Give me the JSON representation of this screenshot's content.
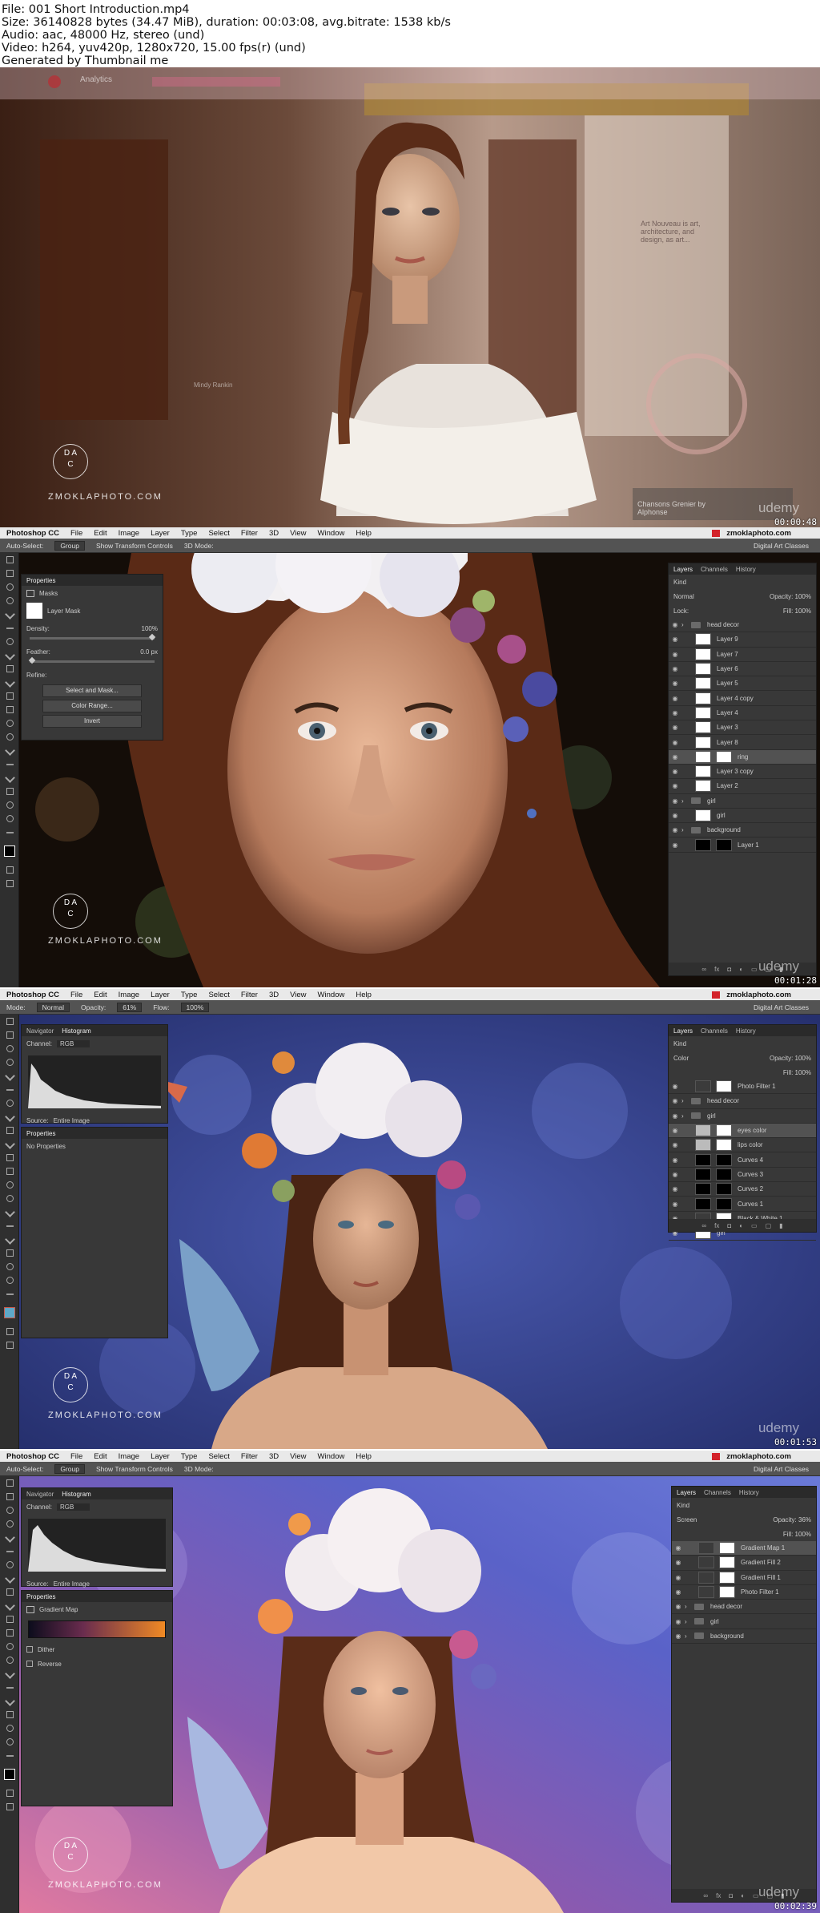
{
  "header": {
    "file": "File: 001 Short Introduction.mp4",
    "size": "Size: 36140828 bytes (34.47 MiB), duration: 00:03:08, avg.bitrate: 1538 kb/s",
    "audio": "Audio: aac, 48000 Hz, stereo (und)",
    "video": "Video: h264, yuv420p, 1280x720, 15.00 fps(r) (und)",
    "generator": "Generated by Thumbnail me"
  },
  "watermark": "ZMOKLAPHOTO.COM",
  "watermark_logo": [
    "D",
    "A",
    "C"
  ],
  "brand": "udemy",
  "menubar": {
    "app": "Photoshop CC",
    "items": [
      "File",
      "Edit",
      "Image",
      "Layer",
      "Type",
      "Select",
      "Filter",
      "3D",
      "View",
      "Window",
      "Help"
    ],
    "site": "zmoklaphoto.com",
    "workspace": "Digital Art Classes"
  },
  "frames": [
    {
      "timestamp": "00:00:48",
      "pinterest": {
        "title": "Analytics",
        "card1": "Art Nouveau is art, architecture, and design, as art...",
        "card2": "Chansons Grenier by Alphonse",
        "card3": "Mindy Rankin"
      }
    },
    {
      "timestamp": "00:01:28",
      "options": [
        "Auto-Select:",
        "Group",
        "Show Transform Controls",
        "3D Mode:"
      ],
      "properties": {
        "tabs": [
          "Properties"
        ],
        "title": "Masks",
        "mask": "Layer Mask",
        "density_label": "Density:",
        "density_value": "100%",
        "feather_label": "Feather:",
        "feather_value": "0.0 px",
        "refine": "Refine:",
        "buttons": [
          "Select and Mask...",
          "Color Range...",
          "Invert"
        ]
      },
      "layers": {
        "tabs": [
          "Layers",
          "Channels",
          "History"
        ],
        "kind": "Kind",
        "blend": "Normal",
        "opacity": "Opacity: 100%",
        "lock": "Lock:",
        "fill": "Fill: 100%",
        "items": [
          {
            "name": "head decor",
            "type": "group"
          },
          {
            "name": "Layer 9",
            "type": "layer"
          },
          {
            "name": "Layer 7",
            "type": "layer"
          },
          {
            "name": "Layer 6",
            "type": "layer"
          },
          {
            "name": "Layer 5",
            "type": "layer"
          },
          {
            "name": "Layer 4 copy",
            "type": "layer"
          },
          {
            "name": "Layer 4",
            "type": "layer"
          },
          {
            "name": "Layer 3",
            "type": "layer"
          },
          {
            "name": "Layer 8",
            "type": "layer"
          },
          {
            "name": "ring",
            "type": "masked",
            "selected": true
          },
          {
            "name": "Layer 3 copy",
            "type": "layer"
          },
          {
            "name": "Layer 2",
            "type": "layer"
          },
          {
            "name": "girl",
            "type": "group"
          },
          {
            "name": "girl",
            "type": "layer"
          },
          {
            "name": "background",
            "type": "group"
          },
          {
            "name": "Layer 1",
            "type": "black"
          }
        ]
      }
    },
    {
      "timestamp": "00:01:53",
      "options": [
        "Mode:",
        "Normal",
        "Opacity:",
        "61%",
        "Flow:",
        "100%"
      ],
      "histogram": {
        "tabs": [
          "Navigator",
          "Histogram"
        ],
        "channel_label": "Channel:",
        "channel": "RGB",
        "source_label": "Source:",
        "source": "Entire Image"
      },
      "properties": {
        "title": "Properties",
        "text": "No Properties"
      },
      "layers": {
        "tabs": [
          "Layers",
          "Channels",
          "History"
        ],
        "kind": "Kind",
        "blend": "Color",
        "opacity": "Opacity: 100%",
        "fill": "Fill: 100%",
        "items": [
          {
            "name": "Photo Filter 1",
            "type": "adjust"
          },
          {
            "name": "head decor",
            "type": "group"
          },
          {
            "name": "girl",
            "type": "group"
          },
          {
            "name": "eyes color",
            "type": "grey",
            "selected": true
          },
          {
            "name": "lips color",
            "type": "grey"
          },
          {
            "name": "Curves 4",
            "type": "black"
          },
          {
            "name": "Curves 3",
            "type": "black"
          },
          {
            "name": "Curves 2",
            "type": "black"
          },
          {
            "name": "Curves 1",
            "type": "black"
          },
          {
            "name": "Black & White 1",
            "type": "adjust"
          },
          {
            "name": "girl",
            "type": "layer"
          }
        ]
      }
    },
    {
      "timestamp": "00:02:39",
      "options": [
        "Auto-Select:",
        "Group",
        "Show Transform Controls",
        "3D Mode:"
      ],
      "histogram": {
        "tabs": [
          "Navigator",
          "Histogram"
        ],
        "channel_label": "Channel:",
        "channel": "RGB",
        "source_label": "Source:",
        "source": "Entire Image"
      },
      "properties": {
        "title": "Properties",
        "map": "Gradient Map",
        "options": [
          "Dither",
          "Reverse"
        ]
      },
      "layers": {
        "tabs": [
          "Layers",
          "Channels",
          "History"
        ],
        "kind": "Kind",
        "blend": "Screen",
        "opacity": "Opacity: 36%",
        "fill": "Fill: 100%",
        "items": [
          {
            "name": "Gradient Map 1",
            "type": "adjust",
            "selected": true
          },
          {
            "name": "Gradient Fill 2",
            "type": "adjust"
          },
          {
            "name": "Gradient Fill 1",
            "type": "adjust"
          },
          {
            "name": "Photo Filter 1",
            "type": "adjust"
          },
          {
            "name": "head decor",
            "type": "group"
          },
          {
            "name": "girl",
            "type": "group"
          },
          {
            "name": "background",
            "type": "group"
          }
        ]
      }
    }
  ],
  "colors": {
    "ps_panel": "#383838",
    "ps_dark": "#2a2a2a",
    "mac_menubar": "#e9e9e9",
    "bg_blue": "#33438f",
    "bg_dark": "#120c08"
  }
}
